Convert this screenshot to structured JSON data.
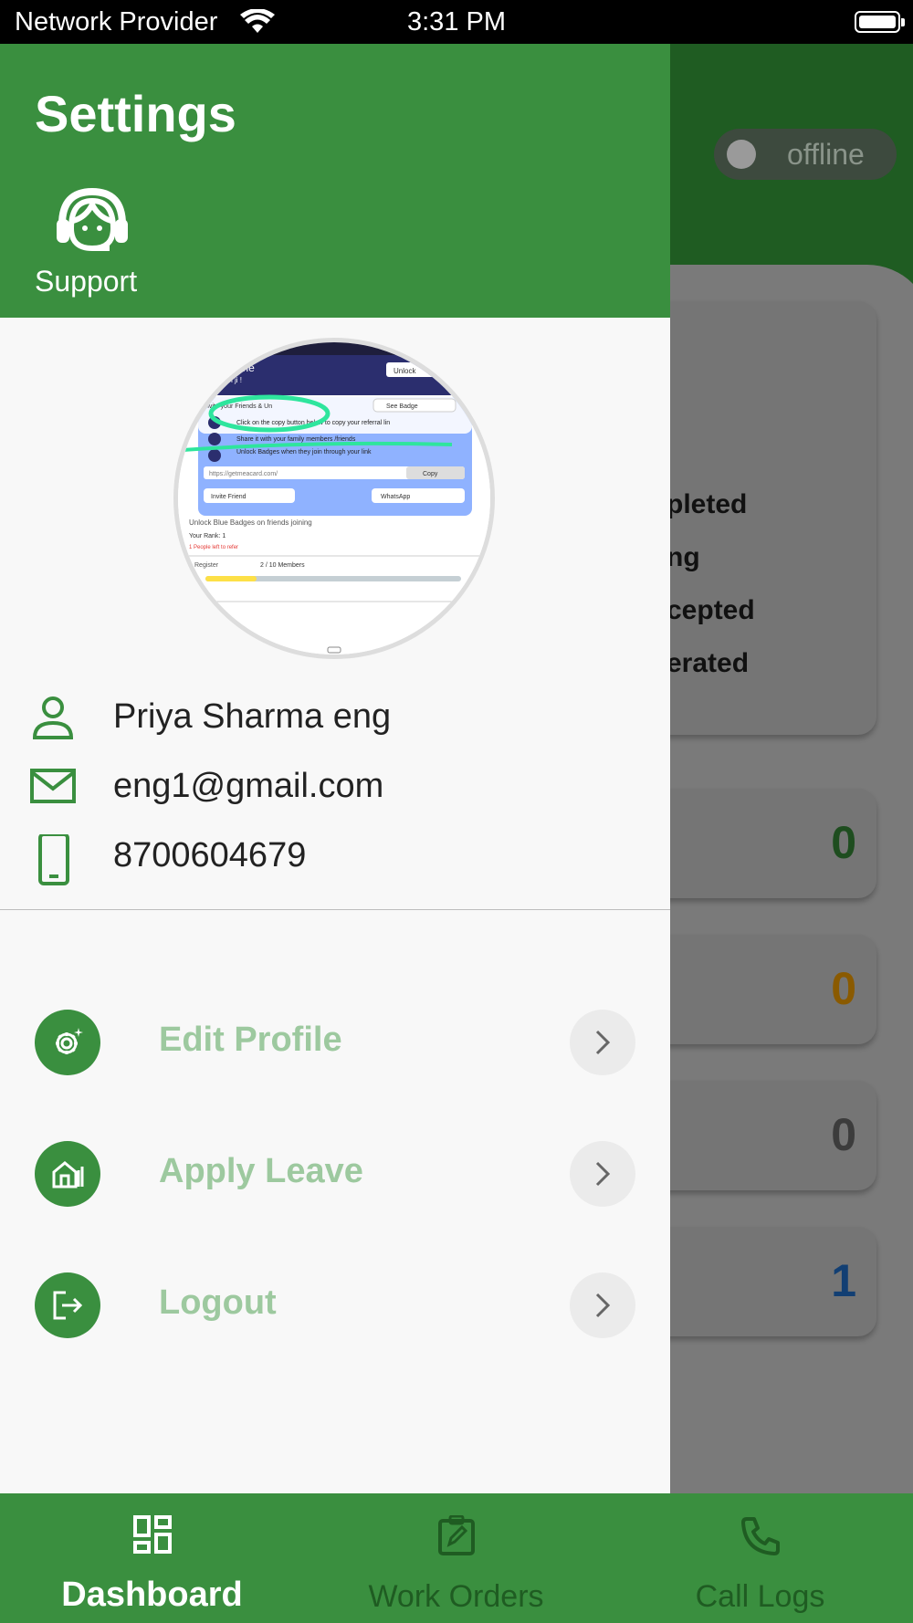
{
  "status_bar": {
    "provider": "Network Provider",
    "time": "3:31 PM"
  },
  "background": {
    "toggle_label": "offline",
    "stats_lines": [
      "pleted",
      "ng",
      "cepted",
      "erated"
    ],
    "counts": [
      {
        "value": "0",
        "color": "#1e4d1f"
      },
      {
        "value": "0",
        "color": "#8a5a00"
      },
      {
        "value": "0",
        "color": "#3c3c3c"
      },
      {
        "value": "1",
        "color": "#123f73"
      }
    ]
  },
  "drawer": {
    "title": "Settings",
    "support_label": "Support",
    "profile": {
      "name": "Priya Sharma eng",
      "email": "eng1@gmail.com",
      "phone": "8700604679"
    },
    "avatar_text": {
      "welcome": "Welcome",
      "user": "yogesh ji !",
      "unlock": "Unlock",
      "invite_heading": "Invite your Friends & Un",
      "see_badge": "See Badge",
      "step1": "Click on the copy button below to copy your referral lin",
      "step2": "Share it with your family members /friends",
      "step3": "Unlock Badges when they join through your link",
      "url": "https://getmeacard.com/",
      "copy": "Copy",
      "invite_friend": "Invite Friend",
      "whatsapp": "WhatsApp",
      "unlock_blue": "Unlock Blue Badges on friends joining",
      "rank": "Your Rank:  1",
      "people_left": "1 People left to refer",
      "register": "Register",
      "members": "2 / 10 Members"
    },
    "menu": [
      {
        "label": "Edit Profile"
      },
      {
        "label": "Apply Leave"
      },
      {
        "label": "Logout"
      }
    ]
  },
  "bottom_nav": [
    {
      "label": "Dashboard",
      "active": true
    },
    {
      "label": "Work Orders",
      "active": false
    },
    {
      "label": "Call Logs",
      "active": false
    }
  ]
}
